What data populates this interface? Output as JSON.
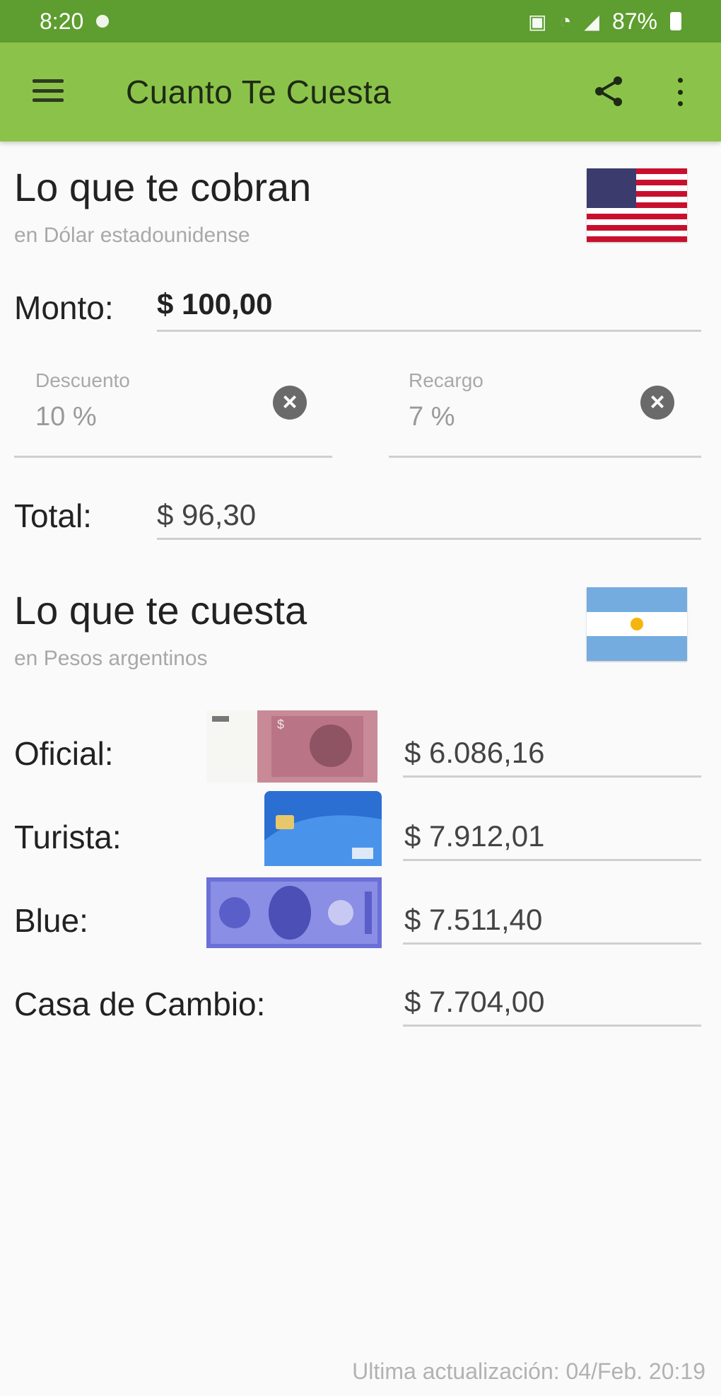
{
  "status_bar": {
    "time": "8:20",
    "battery": "87%"
  },
  "app_bar": {
    "title": "Cuanto Te Cuesta",
    "icons": [
      "menu-icon",
      "share-icon",
      "more-vert-icon"
    ]
  },
  "charged": {
    "title": "Lo que te cobran",
    "subtitle": "en Dólar estadounidense",
    "flag": "us-flag",
    "amount_label": "Monto:",
    "amount_value": "$ 100,00",
    "discount_hint": "Descuento",
    "discount_value": "10 %",
    "surcharge_hint": "Recargo",
    "surcharge_value": "7 %",
    "total_label": "Total:",
    "total_value": "$ 96,30"
  },
  "cost": {
    "title": "Lo que te cuesta",
    "subtitle": "en Pesos argentinos",
    "flag": "argentina-flag",
    "rows": [
      {
        "label": "Oficial:",
        "value": "$ 6.086,16",
        "image": "peso-banknote-image"
      },
      {
        "label": "Turista:",
        "value": "$ 7.912,01",
        "image": "credit-card-image"
      },
      {
        "label": "Blue:",
        "value": "$ 7.511,40",
        "image": "dollar-banknote-image"
      },
      {
        "label": "Casa de Cambio:",
        "value": "$ 7.704,00",
        "image": ""
      }
    ]
  },
  "footer": {
    "last_update": "Ultima actualización: 04/Feb. 20:19"
  },
  "colors": {
    "status_bar": "#5e9d2f",
    "app_bar": "#8bc34a",
    "background": "#fafafa"
  }
}
